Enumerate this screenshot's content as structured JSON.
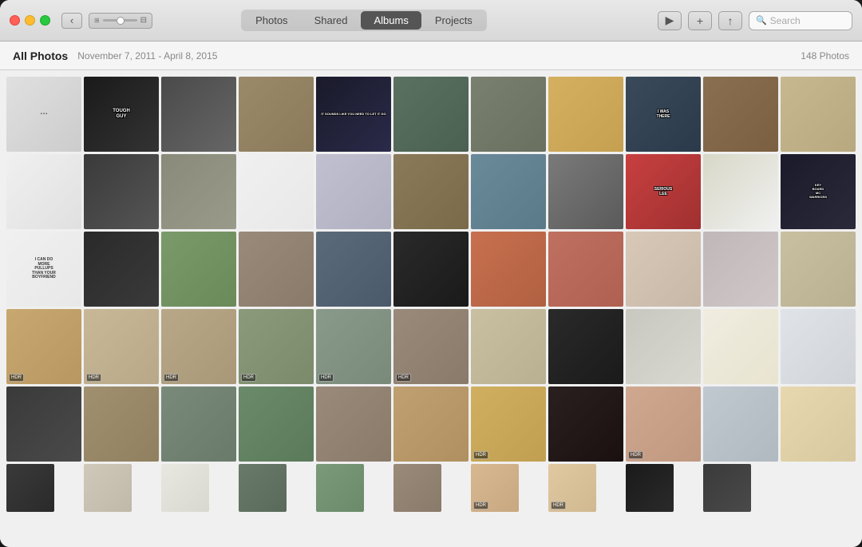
{
  "window": {
    "title": "Photos"
  },
  "titleBar": {
    "tabs": [
      {
        "id": "photos",
        "label": "Photos",
        "active": false
      },
      {
        "id": "shared",
        "label": "Shared",
        "active": false
      },
      {
        "id": "albums",
        "label": "Albums",
        "active": true
      },
      {
        "id": "projects",
        "label": "Projects",
        "active": false
      }
    ],
    "searchPlaceholder": "Search"
  },
  "subtitleBar": {
    "allPhotosLabel": "All Photos",
    "dateRange": "November 7, 2011 - April 8, 2015",
    "photoCount": "148 Photos"
  },
  "photos": {
    "count": 66,
    "memeTexts": {
      "toughGuy": "TOUGH GUY",
      "letItGo": "IT SOUNDS LIKE YOU NEED TO\nLET IT GO",
      "iWasThere": "I WAS THERE",
      "seriousLee": "SERIOUSLEE",
      "pullups": "I CAN DO\nMORE\nPULLUPS\nTHAN YOUR\nBOYFRIEND",
      "keyboardWarriors": "KEY BOARD\nMC\nWARRIORS"
    }
  },
  "toolbar": {
    "playBtn": "▶",
    "addBtn": "+",
    "shareBtn": "↑"
  }
}
